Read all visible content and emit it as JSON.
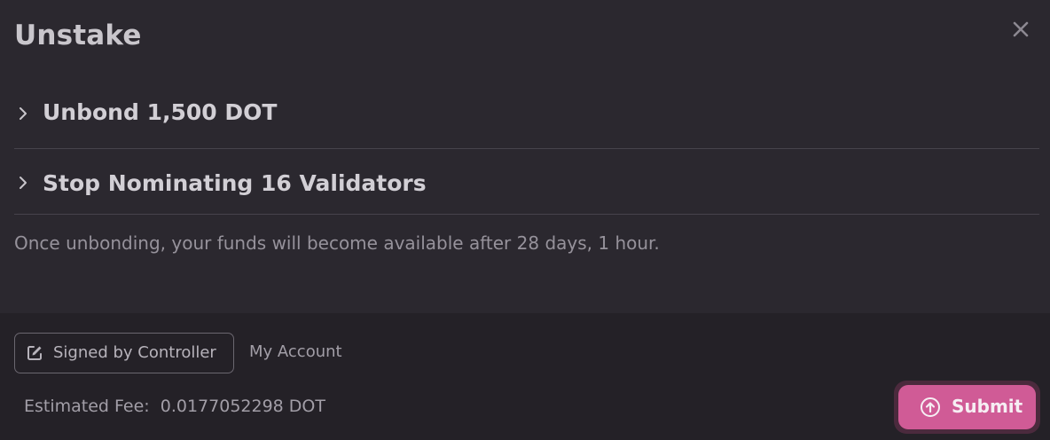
{
  "modal": {
    "title": "Unstake",
    "close_icon": "close-icon"
  },
  "sections": [
    {
      "label": "Unbond 1,500 DOT",
      "icon": "chevron-right-icon",
      "expanded": false
    },
    {
      "label": "Stop Nominating 16 Validators",
      "icon": "chevron-right-icon",
      "expanded": false
    }
  ],
  "info_text": "Once unbonding, your funds will become available after 28 days, 1 hour.",
  "footer": {
    "signer_button": {
      "label": "Signed by Controller",
      "icon": "edit-icon"
    },
    "account_label": "My Account",
    "fee_label": "Estimated Fee:",
    "fee_value": "0.0177052298 DOT",
    "submit_button": {
      "label": "Submit",
      "icon": "arrow-up-circle-icon"
    }
  },
  "colors": {
    "background": "#2b282f",
    "footer_background": "#242127",
    "accent": "#d05b96"
  }
}
